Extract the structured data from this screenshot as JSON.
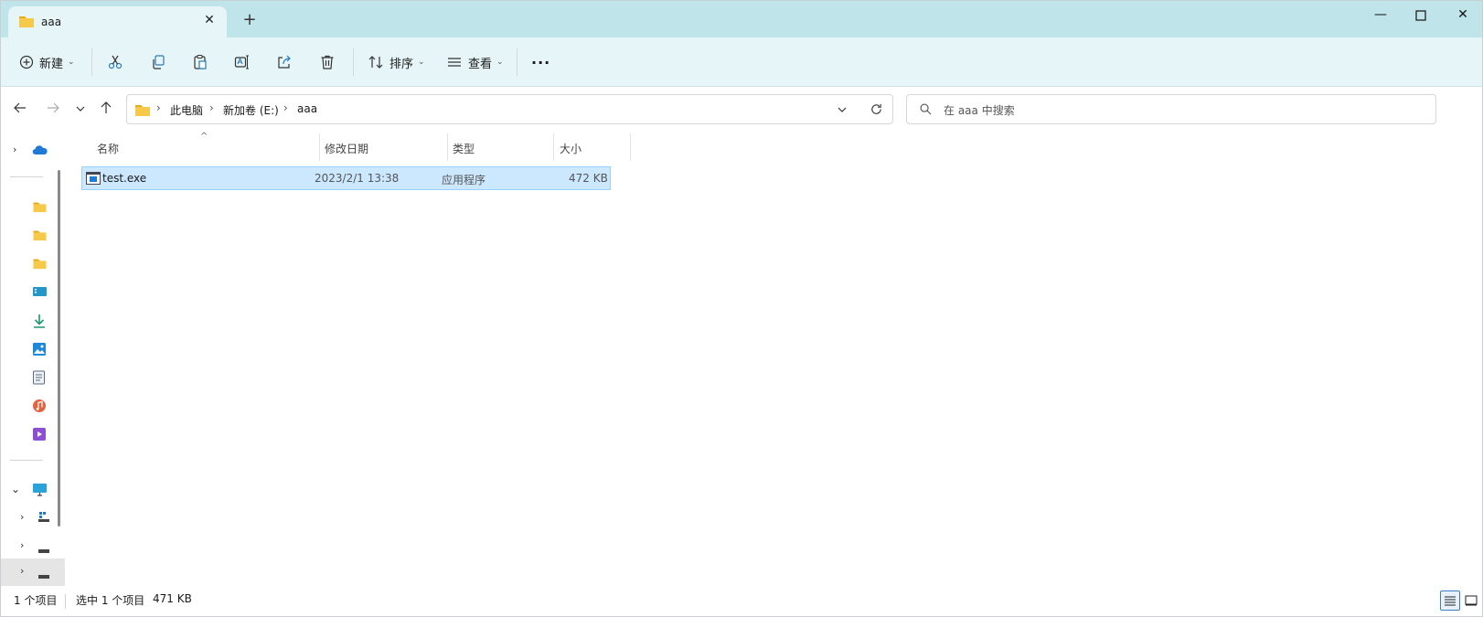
{
  "window": {
    "tab_title": "aaa",
    "new_tab_label": "+",
    "minimize_glyph": "—",
    "maximize_glyph": "☐",
    "close_glyph": "✕",
    "tab_close_glyph": "✕"
  },
  "toolbar": {
    "new_label": "新建",
    "sort_label": "排序",
    "view_label": "查看",
    "more_label": "···",
    "icons": [
      "plus-circle-icon",
      "cut-icon",
      "copy-icon",
      "paste-icon",
      "rename-icon",
      "share-icon",
      "delete-icon",
      "sort-icon",
      "view-icon",
      "more-icon"
    ]
  },
  "address": {
    "crumbs": [
      "此电脑",
      "新加卷 (E:)",
      "aaa"
    ],
    "crumb_sep": "›"
  },
  "search": {
    "placeholder": "在 aaa 中搜索"
  },
  "columns": {
    "name": "名称",
    "modified": "修改日期",
    "type": "类型",
    "size": "大小"
  },
  "files": [
    {
      "name": "test.exe",
      "modified": "2023/2/1 13:38",
      "type": "应用程序",
      "size": "472 KB",
      "selected": true
    }
  ],
  "sidebar": {
    "icons": [
      "onedrive-icon",
      "folder-icon",
      "folder-icon",
      "folder-icon",
      "desktop-icon",
      "download-icon",
      "pictures-icon",
      "documents-icon",
      "music-icon",
      "videos-icon",
      "this-pc-icon",
      "network-drive-icon",
      "drive-icon",
      "drive-icon"
    ]
  },
  "status": {
    "item_count": "1 个项目",
    "selected": "选中 1 个项目",
    "selected_size": "471 KB"
  },
  "colors": {
    "titlebar": "#bfe4e9",
    "toolbar": "#e6f5f7",
    "selection": "#cce8ff",
    "folder": "#f7c948"
  }
}
